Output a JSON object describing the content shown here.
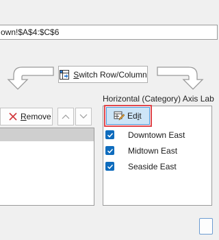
{
  "range_field": {
    "value": "own!$A$4:$C$6"
  },
  "switch_button": {
    "pre": "",
    "accel": "S",
    "post": "witch Row/Column"
  },
  "remove_button": {
    "accel": "R",
    "post": "emove"
  },
  "axis_panel": {
    "title": "Horizontal (Category) Axis Lab"
  },
  "edit_button": {
    "pre": "Ed",
    "accel": "i",
    "post": "t"
  },
  "category_items": [
    {
      "label": "Downtown East",
      "checked": true
    },
    {
      "label": "Midtown East",
      "checked": true
    },
    {
      "label": "Seaside East",
      "checked": true
    }
  ],
  "colors": {
    "accent": "#0f6cbd",
    "highlight": "#e0454a"
  }
}
